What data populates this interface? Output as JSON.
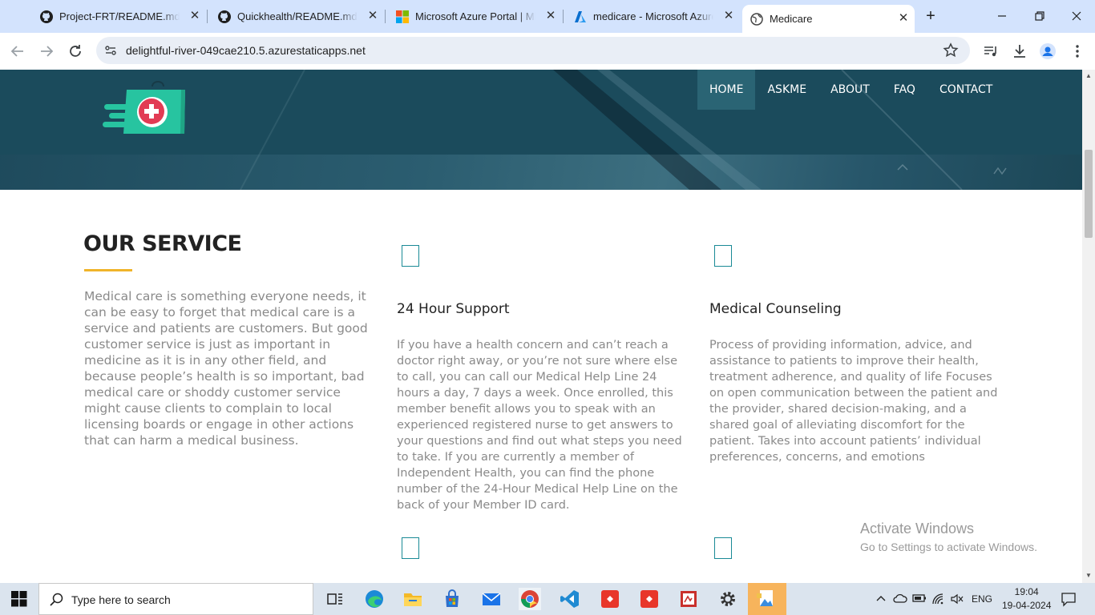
{
  "browser": {
    "tabs": [
      {
        "title": "Project-FRT/README.md at",
        "icon": "github-icon"
      },
      {
        "title": "Quickhealth/README.md at",
        "icon": "github-icon"
      },
      {
        "title": "Microsoft Azure Portal | Mic",
        "icon": "microsoft-icon"
      },
      {
        "title": "medicare - Microsoft Azure",
        "icon": "azure-icon"
      },
      {
        "title": "Medicare",
        "icon": "globe-icon",
        "active": true
      }
    ],
    "new_tab": "+",
    "url": "delightful-river-049cae210.5.azurestaticapps.net"
  },
  "site": {
    "nav": [
      {
        "label": "HOME",
        "active": true
      },
      {
        "label": "ASKME"
      },
      {
        "label": "ABOUT"
      },
      {
        "label": "FAQ"
      },
      {
        "label": "CONTACT"
      }
    ],
    "service": {
      "title": "OUR SERVICE",
      "text": "Medical care is something everyone needs, it can be easy to forget that medical care is a service and patients are customers. But good customer service is just as important in medicine as it is in any other field, and because people’s health is so important, bad medical care or shoddy customer service might cause clients to complain to local licensing boards or engage in other actions that can harm a medical business."
    },
    "cards": [
      {
        "title": "24 Hour Support",
        "text": "If you have a health concern and can’t reach a doctor right away, or you’re not sure where else to call, you can call our Medical Help Line 24 hours a day, 7 days a week. Once enrolled, this member benefit allows you to speak with an experienced registered nurse to get answers to your questions and find out what steps you need to take. If you are currently a member of Independent Health, you can find the phone number of the 24-Hour Medical Help Line on the back of your Member ID card."
      },
      {
        "title": "Medical Counseling",
        "text": "Process of providing information, advice, and assistance to patients to improve their health, treatment adherence, and quality of life Focuses on open communication between the patient and the provider, shared decision-making, and a shared goal of alleviating discomfort for the patient. Takes into account patients’ individual preferences, concerns, and emotions"
      }
    ],
    "colors": {
      "nav_bg": "#1b4b5c",
      "accent_line": "#f0b429",
      "icon_border": "#1a8a96"
    }
  },
  "watermark": {
    "line1": "Activate Windows",
    "line2": "Go to Settings to activate Windows."
  },
  "taskbar": {
    "search_placeholder": "Type here to search",
    "lang": "ENG",
    "time": "19:04",
    "date": "19-04-2024"
  }
}
